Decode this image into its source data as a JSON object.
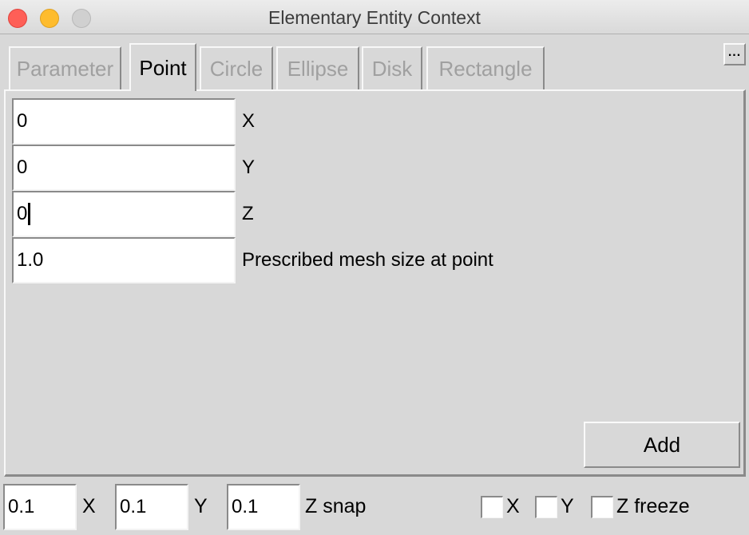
{
  "window": {
    "title": "Elementary Entity Context",
    "controls": [
      "close",
      "minimize",
      "zoom"
    ]
  },
  "tabs": [
    {
      "label": "Parameter",
      "active": false
    },
    {
      "label": "Point",
      "active": true
    },
    {
      "label": "Circle",
      "active": false
    },
    {
      "label": "Ellipse",
      "active": false
    },
    {
      "label": "Disk",
      "active": false
    },
    {
      "label": "Rectangle",
      "active": false
    }
  ],
  "more_button": {
    "label": "..."
  },
  "point_form": {
    "fields": [
      {
        "value": "0",
        "label": "X"
      },
      {
        "value": "0",
        "label": "Y"
      },
      {
        "value": "0",
        "label": "Z",
        "focused": true
      },
      {
        "value": "1.0",
        "label": "Prescribed mesh size at point"
      }
    ],
    "add_button": "Add"
  },
  "snap": {
    "x_value": "0.1",
    "x_label": "X",
    "y_value": "0.1",
    "y_label": "Y",
    "z_value": "0.1",
    "z_label": "Z snap"
  },
  "freeze": {
    "x_label": "X",
    "x_checked": false,
    "y_label": "Y",
    "y_checked": false,
    "z_label": "Z freeze",
    "z_checked": false
  }
}
